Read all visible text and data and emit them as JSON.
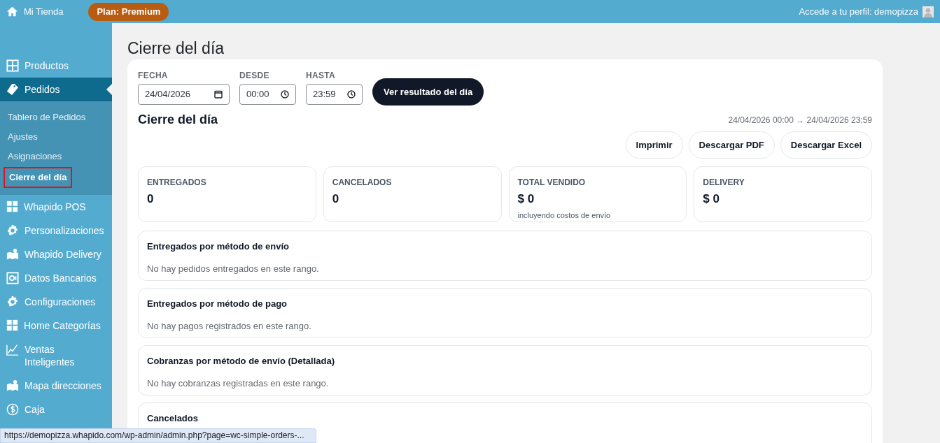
{
  "topbar": {
    "site": "Mi Tienda",
    "plan_badge": "Plan: Premium",
    "profile": "Accede a tu perfil: demopizza"
  },
  "sidebar": {
    "items": [
      {
        "label": "Productos",
        "selected": false
      },
      {
        "label": "Pedidos",
        "selected": true,
        "children": [
          {
            "label": "Tablero de Pedidos",
            "selected": false
          },
          {
            "label": "Ajustes",
            "selected": false
          },
          {
            "label": "Asignaciones",
            "selected": false
          },
          {
            "label": "Cierre del día",
            "selected": true
          }
        ]
      },
      {
        "label": "Whapido POS",
        "selected": false
      },
      {
        "label": "Personalizaciones",
        "selected": false
      },
      {
        "label": "Whapido Delivery",
        "selected": false
      },
      {
        "label": "Datos Bancarios",
        "selected": false
      },
      {
        "label": "Configuraciones",
        "selected": false
      },
      {
        "label": "Home Categorías",
        "selected": false
      },
      {
        "label": "Ventas Inteligentes",
        "selected": false
      },
      {
        "label": "Mapa direcciones",
        "selected": false
      },
      {
        "label": "Caja",
        "selected": false
      }
    ]
  },
  "page_title": "Cierre del día",
  "filters": [
    {
      "label": "FECHA",
      "value": "24/04/2026",
      "kind": "date"
    },
    {
      "label": "DESDE",
      "value": "00:00",
      "kind": "time"
    },
    {
      "label": "HASTA",
      "value": "23:59",
      "kind": "time"
    }
  ],
  "submit_button": "Ver resultado del día",
  "report": {
    "title": "Cierre del día",
    "range": "24/04/2026 00:00 → 24/04/2026 23:59"
  },
  "actions": [
    "Imprimir",
    "Descargar PDF",
    "Descargar Excel"
  ],
  "stats": [
    {
      "label": "ENTREGADOS",
      "value": "0"
    },
    {
      "label": "CANCELADOS",
      "value": "0"
    },
    {
      "label": "TOTAL VENDIDO",
      "value": "$ 0",
      "note": "incluyendo costos de envío"
    },
    {
      "label": "DELIVERY",
      "value": "$ 0"
    }
  ],
  "sections": [
    {
      "title": "Entregados por método de envío",
      "message": "No hay pedidos entregados en este rango."
    },
    {
      "title": "Entregados por método de pago",
      "message": "No hay pagos registrados en este rango."
    },
    {
      "title": "Cobranzas por método de envío (Detallada)",
      "message": "No hay cobranzas registradas en este rango."
    },
    {
      "title": "Cancelados"
    }
  ],
  "status_bar": {
    "url": "https://demopizza.whapido.com/wp-admin/admin.php?page=wc-simple-orders-..."
  }
}
